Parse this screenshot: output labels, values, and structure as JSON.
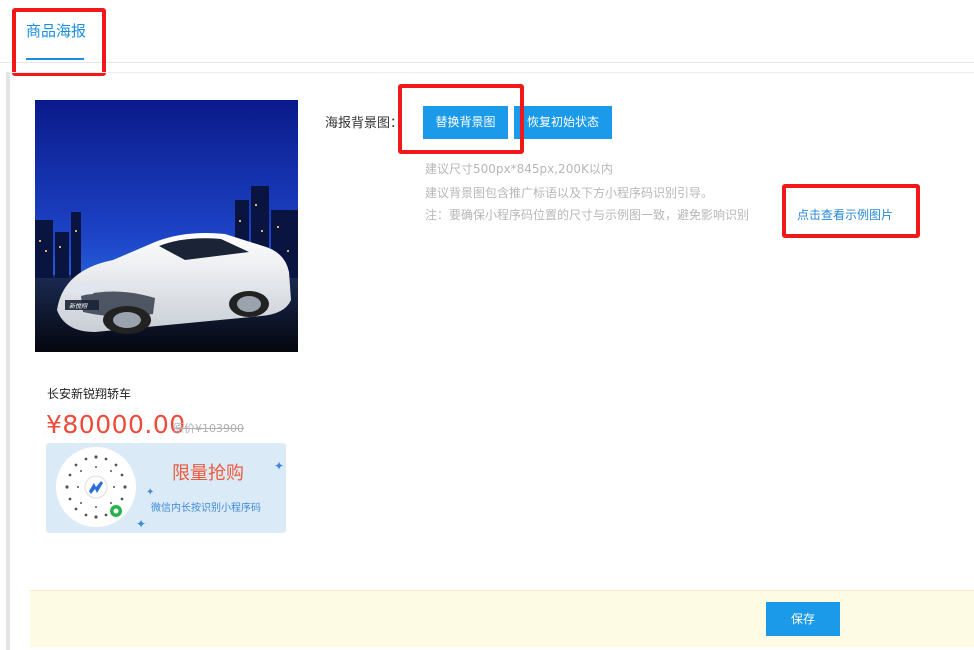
{
  "tabs": [
    {
      "label": "商品海报",
      "active": true
    }
  ],
  "poster": {
    "car_badge_text": "新悦翔",
    "product_name": "长安新锐翔轿车",
    "price": "¥80000.00",
    "original_price": "原价¥103900",
    "promo_title": "限量抢购",
    "promo_subtitle": "微信内长按识别小程序码"
  },
  "background_setting": {
    "label": "海报背景图：",
    "replace_button": "替换背景图",
    "reset_button": "恢复初始状态",
    "hints": [
      "建议尺寸500px*845px,200K以内",
      "建议背景图包含推广标语以及下方小程序码识别引导。",
      "注：要确保小程序码位置的尺寸与示例图一致，避免影响识别"
    ],
    "example_link": "点击查看示例图片"
  },
  "footer": {
    "save_button": "保存"
  },
  "colors": {
    "accent": "#1a9ae8",
    "price": "#ef4a3a",
    "highlight_box": "#f01818",
    "footer_bg": "#fdfbe3",
    "promo_bg": "#dbeaf7"
  }
}
